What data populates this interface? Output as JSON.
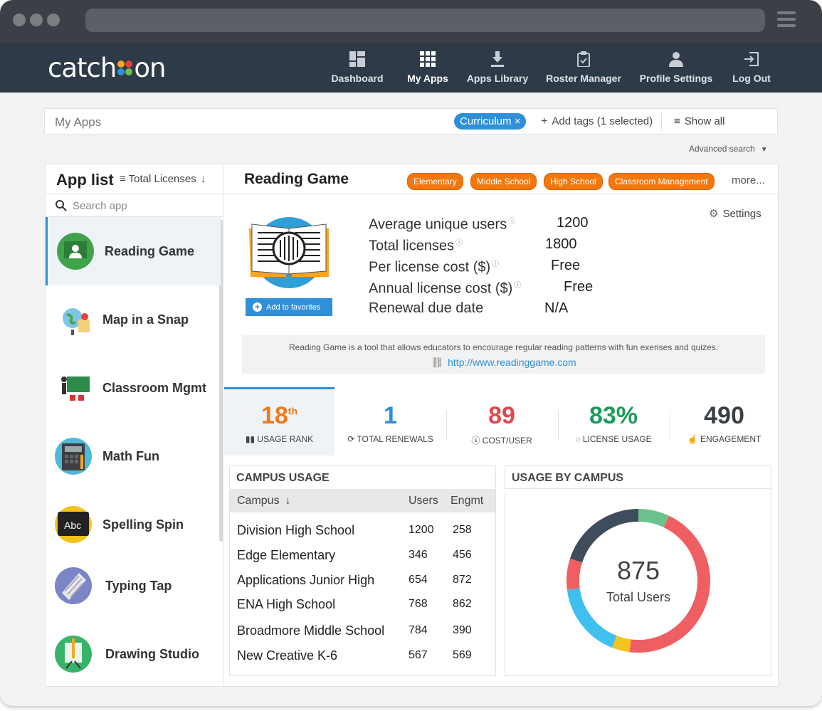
{
  "nav": {
    "logo": "catch  on",
    "items": [
      {
        "label": "Dashboard",
        "icon": "dashboard-icon"
      },
      {
        "label": "My Apps",
        "icon": "apps-grid-icon"
      },
      {
        "label": "Apps Library",
        "icon": "download-icon"
      },
      {
        "label": "Roster Manager",
        "icon": "clipboard-icon"
      },
      {
        "label": "Profile Settings",
        "icon": "person-icon"
      },
      {
        "label": "Log Out",
        "icon": "logout-icon"
      }
    ]
  },
  "filter": {
    "title": "My Apps",
    "chip": "Curriculum",
    "chip_close": "×",
    "add_tags": "Add tags (1 selected)",
    "show_all": "Show all",
    "advanced": "Advanced search"
  },
  "applist": {
    "title": "App list",
    "sort": "Total Licenses",
    "search_placeholder": "Search app",
    "apps": [
      "Reading Game",
      "Map in a Snap",
      "Classroom Mgmt",
      "Math Fun",
      "Spelling Spin",
      "Typing Tap",
      "Drawing Studio"
    ]
  },
  "detail": {
    "title": "Reading Game",
    "tags": [
      "Elementary",
      "Middle School",
      "High School",
      "Classroom Management"
    ],
    "more": "more...",
    "settings": "Settings",
    "add_fav": "Add to favorites",
    "metrics": [
      {
        "label": "Average unique users",
        "value": "1200"
      },
      {
        "label": "Total licenses",
        "value": "1800"
      },
      {
        "label": "Per license cost ($)",
        "value": "Free"
      },
      {
        "label": "Annual license cost ($)",
        "value": "Free"
      },
      {
        "label": "Renewal due date",
        "value": "N/A"
      }
    ],
    "description": "Reading Game is a tool that allows educators to encourage regular reading patterns with fun exerises and quizes.",
    "link": "http://www.readinggame.com"
  },
  "stats": [
    {
      "value": "18",
      "sup": "th",
      "label": "USAGE RANK",
      "color": "#f07b16",
      "icon": "bar-chart-icon"
    },
    {
      "value": "1",
      "label": "TOTAL RENEWALS",
      "color": "#2f8fd8",
      "icon": "refresh-icon"
    },
    {
      "value": "89",
      "label": "COST/USER",
      "color": "#e0474c",
      "icon": "dollar-icon"
    },
    {
      "value": "83%",
      "label": "LICENSE USAGE",
      "color": "#1d9a5a",
      "icon": "circle-progress-icon"
    },
    {
      "value": "490",
      "label": "ENGAGEMENT",
      "color": "#3a4048",
      "icon": "pointer-icon"
    }
  ],
  "campus": {
    "title": "CAMPUS USAGE",
    "headers": [
      "Campus",
      "Users",
      "Engmt"
    ],
    "rows": [
      [
        "Division High School",
        "1200",
        "258"
      ],
      [
        "Edge Elementary",
        "346",
        "456"
      ],
      [
        "Applications Junior High",
        "654",
        "872"
      ],
      [
        "ENA High School",
        "768",
        "862"
      ],
      [
        "Broadmore Middle School",
        "784",
        "390"
      ],
      [
        "New Creative K-6",
        "567",
        "569"
      ]
    ]
  },
  "donut": {
    "title": "USAGE BY CAMPUS",
    "total": "875",
    "caption": "Total Users",
    "segments": [
      {
        "value": 7,
        "color": "#6cc28c"
      },
      {
        "value": 45,
        "color": "#ef5f62"
      },
      {
        "value": 4,
        "color": "#f6c21c"
      },
      {
        "value": 17,
        "color": "#3fc0ee"
      },
      {
        "value": 7,
        "color": "#ef5f62"
      },
      {
        "value": 20,
        "color": "#3f4c5b"
      }
    ]
  }
}
